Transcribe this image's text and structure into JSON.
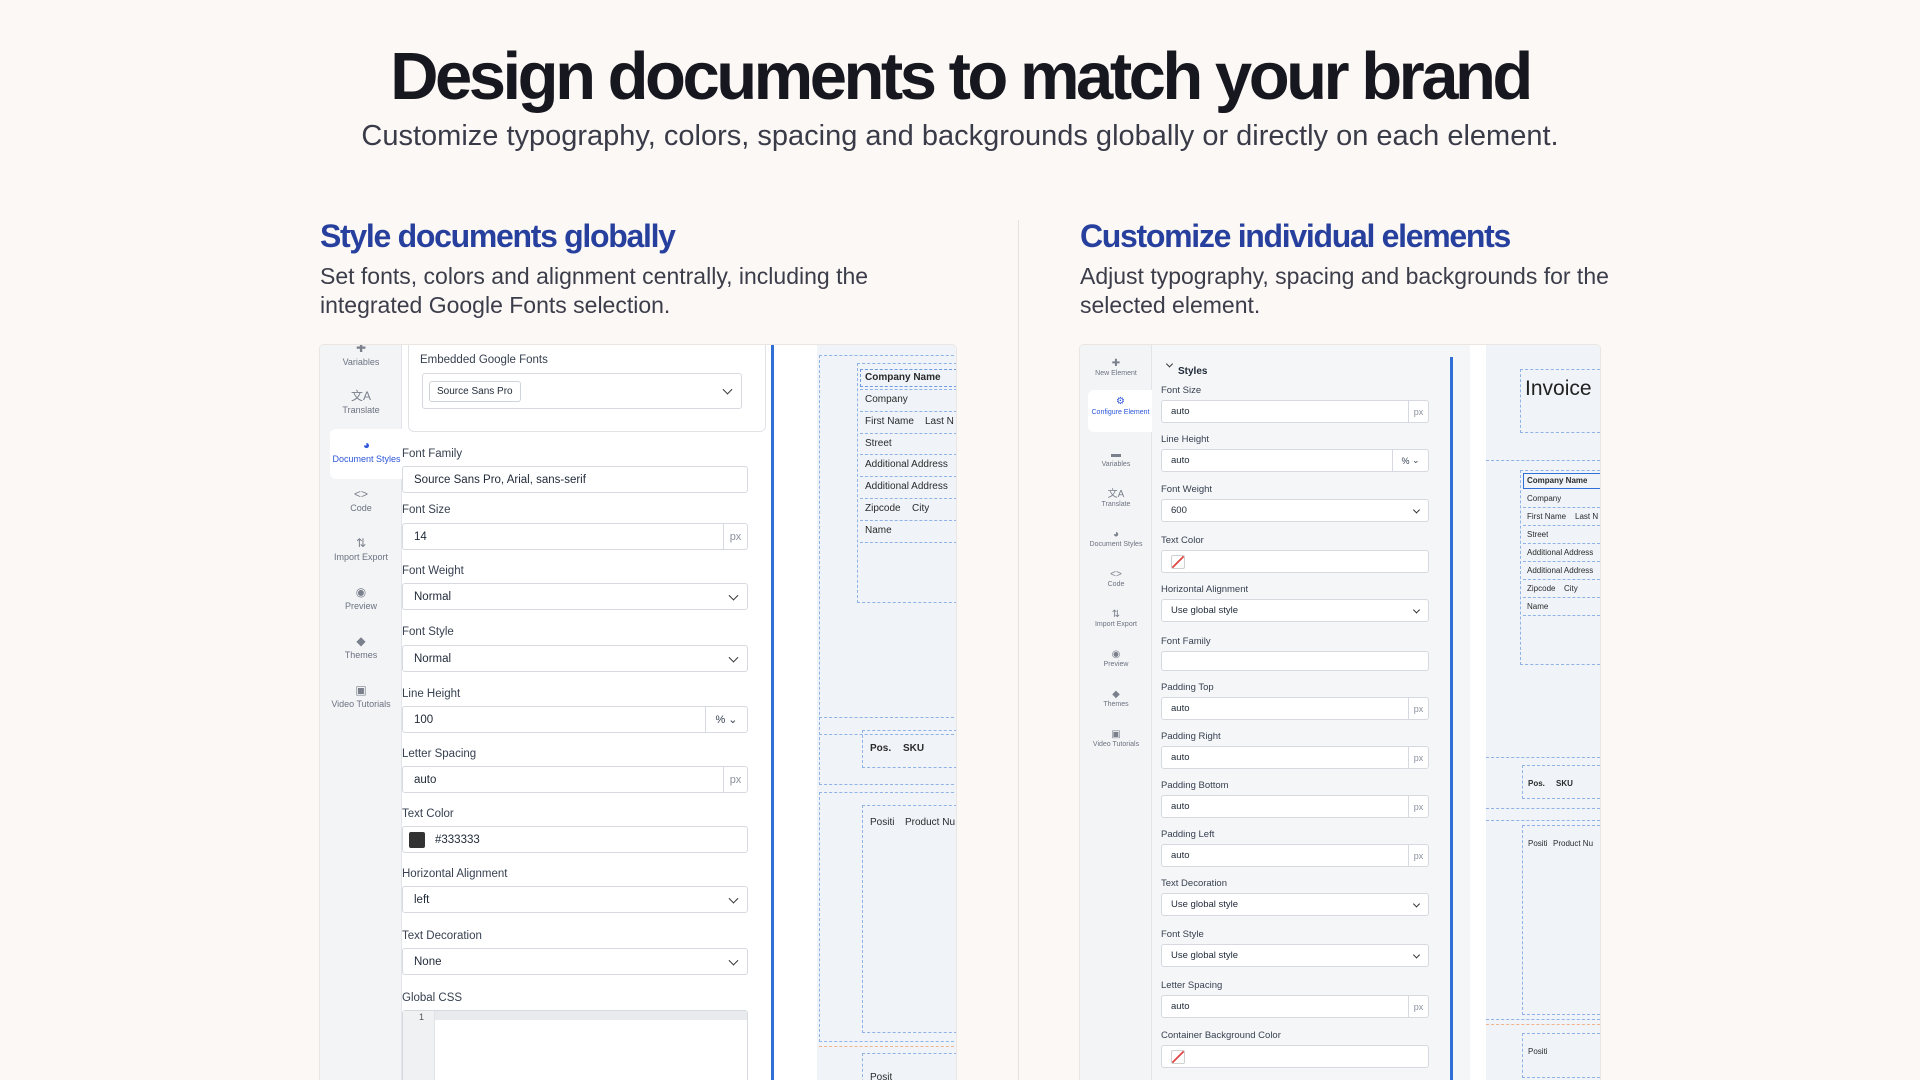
{
  "hero": {
    "title": "Design documents to match your brand",
    "subtitle": "Customize typography, colors, spacing and backgrounds globally or directly on each element."
  },
  "left_section": {
    "title": "Style documents globally",
    "description": "Set fonts, colors and alignment centrally, including the integrated Google Fonts selection."
  },
  "right_section": {
    "title": "Customize individual elements",
    "description": "Adjust typography, spacing and backgrounds for the selected element."
  },
  "left_sidebar": [
    {
      "label": "Variables",
      "icon": "puzzle-icon"
    },
    {
      "label": "Translate",
      "icon": "translate-icon"
    },
    {
      "label": "Document Styles",
      "icon": "palette-icon",
      "active": true
    },
    {
      "label": "Code",
      "icon": "code-icon"
    },
    {
      "label": "Import Export",
      "icon": "import-export-icon"
    },
    {
      "label": "Preview",
      "icon": "eye-icon"
    },
    {
      "label": "Themes",
      "icon": "themes-icon"
    },
    {
      "label": "Video Tutorials",
      "icon": "video-icon"
    }
  ],
  "left_form": {
    "google_fonts_label": "Embedded Google Fonts",
    "google_fonts_value": "Source Sans Pro",
    "font_family_label": "Font Family",
    "font_family_value": "Source Sans Pro, Arial, sans-serif",
    "font_size_label": "Font Size",
    "font_size_value": "14",
    "font_size_unit": "px",
    "font_weight_label": "Font Weight",
    "font_weight_value": "Normal",
    "font_style_label": "Font Style",
    "font_style_value": "Normal",
    "line_height_label": "Line Height",
    "line_height_value": "100",
    "line_height_unit": "%",
    "letter_spacing_label": "Letter Spacing",
    "letter_spacing_value": "auto",
    "letter_spacing_unit": "px",
    "text_color_label": "Text Color",
    "text_color_value": "#333333",
    "h_align_label": "Horizontal Alignment",
    "h_align_value": "left",
    "text_decoration_label": "Text Decoration",
    "text_decoration_value": "None",
    "global_css_label": "Global CSS",
    "global_css_line": "1"
  },
  "left_canvas": {
    "rows": [
      "Company Name",
      "Company",
      "First Name",
      "Last N",
      "Street",
      "Additional Address",
      "Additional Address",
      "Zipcode",
      "City",
      "Name"
    ],
    "table_head": [
      "Pos.",
      "SKU"
    ],
    "table_row": [
      "Positi",
      "Product Nu"
    ],
    "bottom_cell": "Posit"
  },
  "right_sidebar": [
    {
      "label": "New Element",
      "icon": "puzzle-icon"
    },
    {
      "label": "Configure Element",
      "icon": "gear-icon",
      "active": true
    },
    {
      "label": "Variables",
      "icon": "variables-icon"
    },
    {
      "label": "Translate",
      "icon": "translate-icon"
    },
    {
      "label": "Document Styles",
      "icon": "palette-icon"
    },
    {
      "label": "Code",
      "icon": "code-icon"
    },
    {
      "label": "Import Export",
      "icon": "import-export-icon"
    },
    {
      "label": "Preview",
      "icon": "eye-icon"
    },
    {
      "label": "Themes",
      "icon": "themes-icon"
    },
    {
      "label": "Video Tutorials",
      "icon": "video-icon"
    }
  ],
  "right_form": {
    "section_title": "Styles",
    "font_size_label": "Font Size",
    "font_size_value": "auto",
    "px": "px",
    "line_height_label": "Line Height",
    "line_height_value": "auto",
    "pct": "%",
    "font_weight_label": "Font Weight",
    "font_weight_value": "600",
    "text_color_label": "Text Color",
    "h_align_label": "Horizontal Alignment",
    "h_align_value": "Use global style",
    "font_family_label": "Font Family",
    "padding_top_label": "Padding Top",
    "padding_top_value": "auto",
    "padding_right_label": "Padding Right",
    "padding_right_value": "auto",
    "padding_bottom_label": "Padding Bottom",
    "padding_bottom_value": "auto",
    "padding_left_label": "Padding Left",
    "padding_left_value": "auto",
    "text_decoration_label": "Text Decoration",
    "text_decoration_value": "Use global style",
    "font_style_label": "Font Style",
    "font_style_value": "Use global style",
    "letter_spacing_label": "Letter Spacing",
    "letter_spacing_value": "auto",
    "container_bg_label": "Container Background Color"
  },
  "right_canvas": {
    "invoice_title": "Invoice",
    "rows": [
      "Company Name",
      "Company",
      "First Name",
      "Last N",
      "Street",
      "Additional Address",
      "Additional Address",
      "Zipcode",
      "City",
      "Name"
    ],
    "table_head": [
      "Pos.",
      "SKU"
    ],
    "table_row": [
      "Positi",
      "Product Nu"
    ],
    "bottom_cell": "Positi"
  },
  "colors": {
    "accent_blue": "#2f6fd6",
    "section_title_blue": "#27409e",
    "background": "#fcf8f5"
  }
}
